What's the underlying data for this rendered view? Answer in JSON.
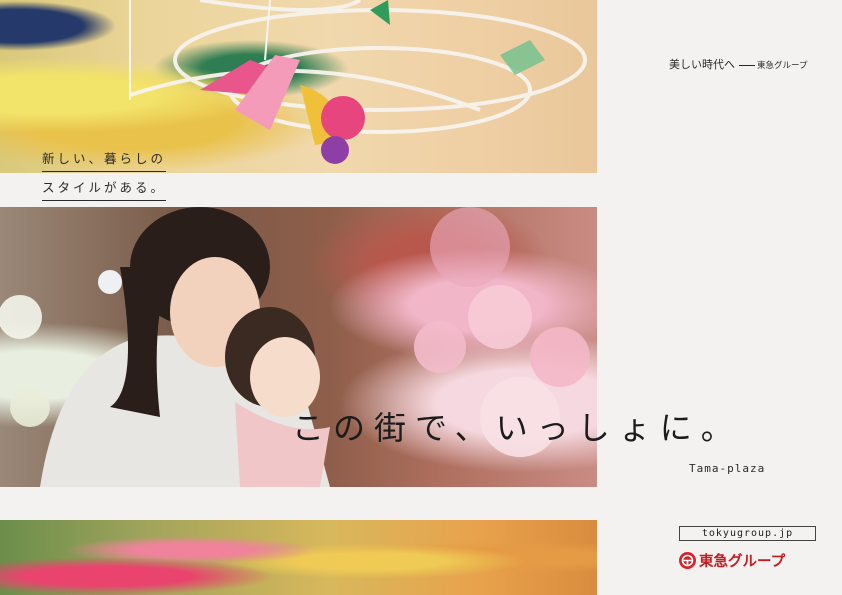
{
  "header": {
    "slogan": "美しい時代へ",
    "group_name": "東急グループ"
  },
  "taglines": [
    "新しい、暮らしの",
    "スタイルがある。"
  ],
  "headline": "この街で、いっしょに。",
  "place_name": "Tama-plaza",
  "footer": {
    "url": "tokyugroup.jp",
    "logo_text": "東急グループ"
  },
  "colors": {
    "brand_red": "#d6232a",
    "background": "#f3f2f1"
  }
}
